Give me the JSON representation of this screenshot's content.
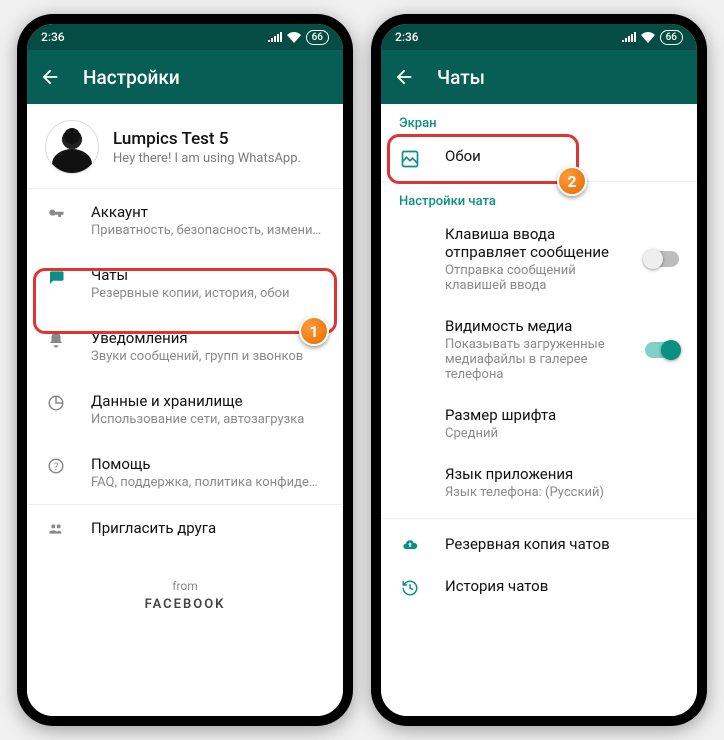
{
  "status": {
    "time": "2:36",
    "battery": "66"
  },
  "left": {
    "title": "Настройки",
    "profile": {
      "name": "Lumpics Test 5",
      "status": "Hey there! I am using WhatsApp."
    },
    "items": [
      {
        "label": "Аккаунт",
        "sub": "Приватность, безопасность, изменить номер"
      },
      {
        "label": "Чаты",
        "sub": "Резервные копии, история, обои"
      },
      {
        "label": "Уведомления",
        "sub": "Звуки сообщений, групп и звонков"
      },
      {
        "label": "Данные и хранилище",
        "sub": "Использование сети, автозагрузка"
      },
      {
        "label": "Помощь",
        "sub": "FAQ, поддержка, политика конфиденциальности"
      },
      {
        "label": "Пригласить друга",
        "sub": ""
      }
    ],
    "footer": {
      "from": "from",
      "brand": "FACEBOOK"
    }
  },
  "right": {
    "title": "Чаты",
    "section_screen": "Экран",
    "wallpaper": {
      "label": "Обои"
    },
    "section_chat": "Настройки чата",
    "enter_send": {
      "label": "Клавиша ввода отправляет сообщение",
      "sub": "Отправка сообщений клавишей ввода"
    },
    "media_vis": {
      "label": "Видимость медиа",
      "sub": "Показывать загруженные медиафайлы в галерее телефона"
    },
    "font_size": {
      "label": "Размер шрифта",
      "sub": "Средний"
    },
    "lang": {
      "label": "Язык приложения",
      "sub": "Язык телефона: (Русский)"
    },
    "backup": {
      "label": "Резервная копия чатов"
    },
    "history": {
      "label": "История чатов"
    }
  },
  "steps": {
    "one": "1",
    "two": "2"
  }
}
